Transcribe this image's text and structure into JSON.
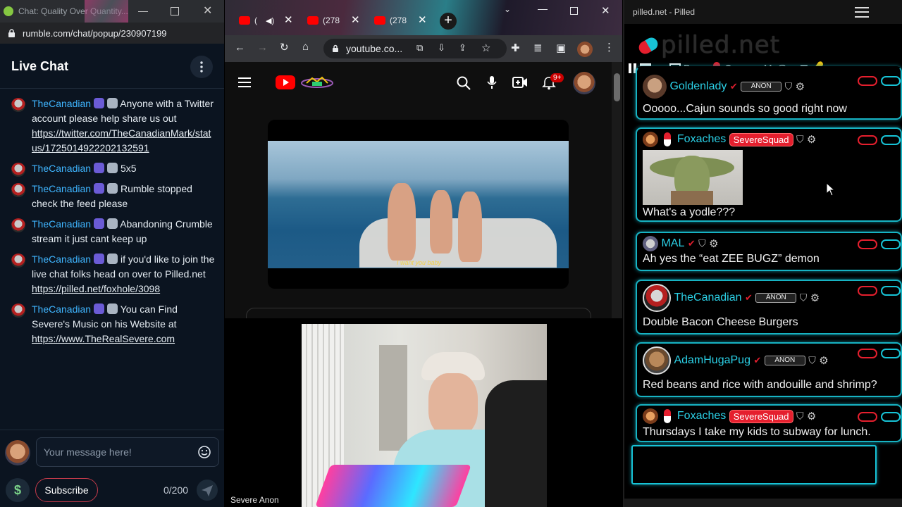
{
  "rumble": {
    "title_bar_text": "Chat: Quality Over Quantity...",
    "url": "rumble.com/chat/popup/230907199",
    "header": "Live Chat",
    "messages": [
      {
        "user": "TheCanadian",
        "text": "Anyone with a Twitter account please help share us out",
        "link": "https://twitter.com/TheCanadianMark/status/1725014922202132591"
      },
      {
        "user": "TheCanadian",
        "text": "5x5",
        "link": ""
      },
      {
        "user": "TheCanadian",
        "text": "Rumble stopped check the feed please",
        "link": ""
      },
      {
        "user": "TheCanadian",
        "text": "Abandoning Crumble stream it just cant keep up",
        "link": ""
      },
      {
        "user": "TheCanadian",
        "text": "if you'd like to join the live chat folks head on over to Pilled.net",
        "link": "https://pilled.net/foxhole/3098"
      },
      {
        "user": "TheCanadian",
        "text": "You can Find Severe's Music on his Website at",
        "link": "https://www.TheRealSevere.com"
      }
    ],
    "composer": {
      "placeholder": "Your message here!",
      "subscribe_label": "Subscribe",
      "dollar_label": "$",
      "counter": "0/200"
    }
  },
  "youtube": {
    "tabs": [
      {
        "label": "("
      },
      {
        "label": "(278"
      },
      {
        "label": "(278"
      }
    ],
    "new_tab": "+",
    "url": "youtube.co...",
    "notification_count": "9+",
    "video_caption": "I want you baby"
  },
  "webcam": {
    "label": "Severe Anon"
  },
  "pilled": {
    "title_bar_text": "pilled.net - Pilled",
    "logo_text": "pilled.net",
    "toolbar": {
      "pop_label": "Pop",
      "on_label": "On",
      "my_label": "My@"
    },
    "cards": [
      {
        "user": "Goldenlady",
        "badge": "ANON",
        "text": "Ooooo...Cajun sounds so good right now"
      },
      {
        "user": "Foxaches",
        "tag": "SevereSquad",
        "text": "What's a yodle???"
      },
      {
        "user": "MAL",
        "text": "Ah yes the “eat ZEE BUGZ” demon"
      },
      {
        "user": "TheCanadian",
        "badge": "ANON",
        "text": "Double Bacon Cheese Burgers"
      },
      {
        "user": "AdamHugaPug",
        "badge": "ANON",
        "text": "Red beans and rice with andouille and shrimp?"
      },
      {
        "user": "Foxaches",
        "tag": "SevereSquad",
        "text": "Thursdays I take my kids to subway for lunch."
      }
    ]
  },
  "colors": {
    "rumble_bg": "#0b1420",
    "rumble_user": "#3fb5ff",
    "pilled_accent": "#17b3c3",
    "pilled_tag": "#e51f2e",
    "yt_red": "#ff0000"
  }
}
